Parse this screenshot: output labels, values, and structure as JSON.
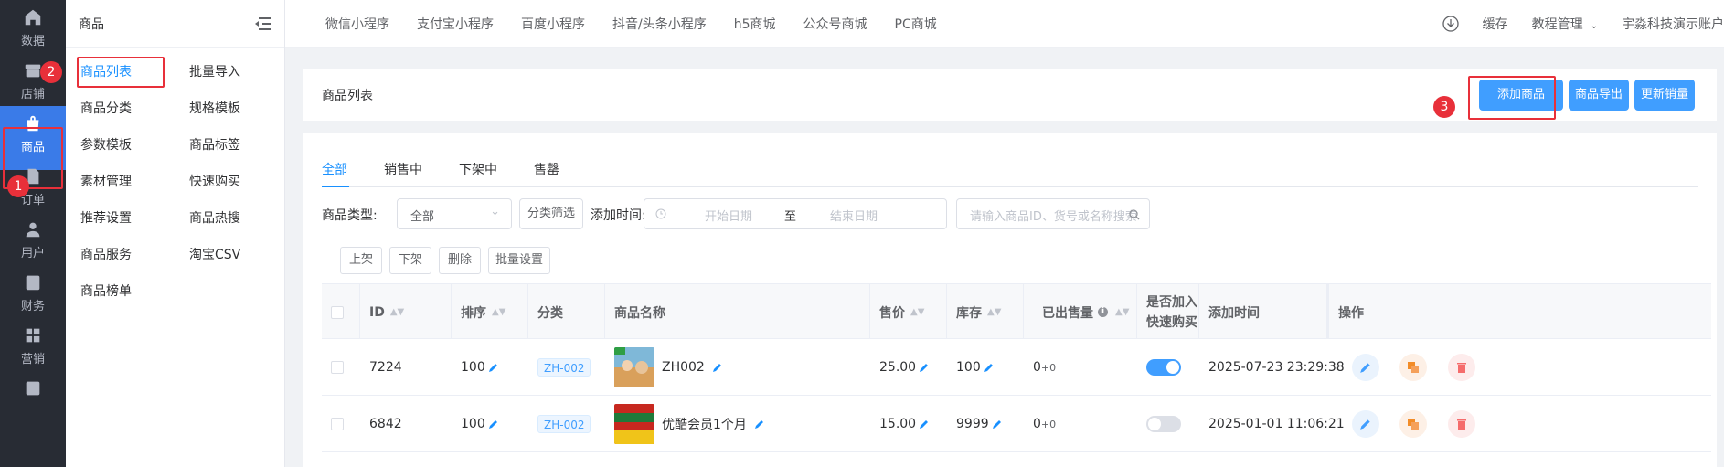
{
  "rail": {
    "items": [
      {
        "label": "数据",
        "icon": "home-icon"
      },
      {
        "label": "店铺",
        "icon": "shop-icon"
      },
      {
        "label": "商品",
        "icon": "shopping-bag-icon"
      },
      {
        "label": "订单",
        "icon": "document-icon"
      },
      {
        "label": "用户",
        "icon": "user-icon"
      },
      {
        "label": "财务",
        "icon": "finance-icon"
      },
      {
        "label": "营销",
        "icon": "grid-icon"
      }
    ]
  },
  "submenu": {
    "title": "商品",
    "left": [
      "商品列表",
      "商品分类",
      "参数模板",
      "素材管理",
      "推荐设置",
      "商品服务",
      "商品榜单"
    ],
    "right": [
      "批量导入",
      "规格模板",
      "商品标签",
      "快速购买",
      "商品热搜",
      "淘宝CSV"
    ]
  },
  "topbar": {
    "tabs": [
      "微信小程序",
      "支付宝小程序",
      "百度小程序",
      "抖音/头条小程序",
      "h5商城",
      "公众号商城",
      "PC商城"
    ],
    "cache": "缓存",
    "tutorial": "教程管理",
    "account": "宇淼科技演示账户"
  },
  "header": {
    "title": "商品列表",
    "add": "添加商品",
    "export": "商品导出",
    "update_sales": "更新销量"
  },
  "tabs": [
    "全部",
    "销售中",
    "下架中",
    "售罄"
  ],
  "filter": {
    "type_label": "商品类型:",
    "type_value": "全部",
    "category_btn": "分类筛选",
    "time_label": "添加时间:",
    "start_ph": "开始日期",
    "to": "至",
    "end_ph": "结束日期",
    "search_ph": "请输入商品ID、货号或名称搜索"
  },
  "actions": [
    "上架",
    "下架",
    "删除",
    "批量设置"
  ],
  "columns": {
    "id": "ID",
    "sort": "排序",
    "category": "分类",
    "name": "商品名称",
    "price": "售价",
    "stock": "库存",
    "sold": "已出售量",
    "quick_1": "是否加入",
    "quick_2": "快速购买",
    "added": "添加时间",
    "ops": "操作"
  },
  "rows": [
    {
      "id": "7224",
      "sort": "100",
      "category": "ZH-002",
      "name": "ZH002",
      "price": "25.00",
      "stock": "100",
      "sold_main": "0",
      "sold_extra": "+0",
      "quick": true,
      "added": "2025-07-23 23:29:38"
    },
    {
      "id": "6842",
      "sort": "100",
      "category": "ZH-002",
      "name": "优酷会员1个月",
      "price": "15.00",
      "stock": "9999",
      "sold_main": "0",
      "sold_extra": "+0",
      "quick": false,
      "added": "2025-01-01 11:06:21"
    }
  ],
  "annotations": [
    "1",
    "2",
    "3"
  ],
  "colors": {
    "primary": "#409eff",
    "active": "#1890ff",
    "rail": "#282c34",
    "highlight": "#e8303a"
  }
}
